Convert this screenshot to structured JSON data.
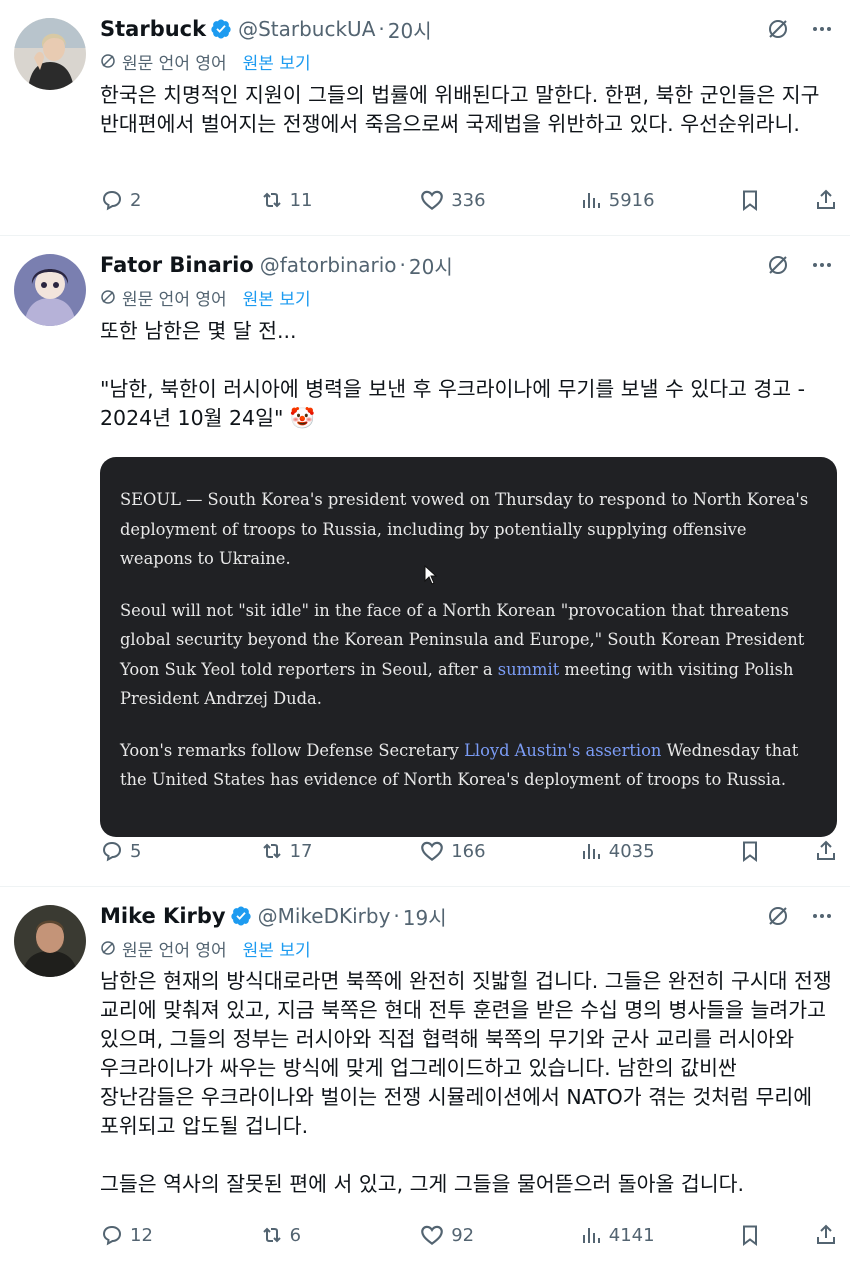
{
  "tweets": [
    {
      "name": "Starbuck",
      "verified": true,
      "handle": "@StarbuckUA",
      "time": "20시",
      "translate_label": "원문 언어 영어",
      "show_original": "원본 보기",
      "text": [
        "한국은 치명적인 지원이 그들의 법률에 위배된다고 말한다. 한편, 북한 군인들은 지구 반대편에서 벌어지는 전쟁에서 죽음으로써 국제법을 위반하고 있다. 우선순위라니."
      ],
      "replies": "2",
      "reposts": "11",
      "likes": "336",
      "views": "5916"
    },
    {
      "name": "Fator Binario",
      "verified": false,
      "handle": "@fatorbinario",
      "time": "20시",
      "translate_label": "원문 언어 영어",
      "show_original": "원본 보기",
      "text": [
        "또한 남한은 몇 달 전...",
        "\"남한, 북한이 러시아에 병력을 보낸 후 우크라이나에 무기를 보낼 수 있다고 경고 - 2024년 10월 24일\" 🤡"
      ],
      "quote": {
        "p1": "SEOUL — South Korea's president vowed on Thursday to respond to North Korea's deployment of troops to Russia, including by potentially supplying offensive weapons to Ukraine.",
        "p2_a": "Seoul will not \"sit idle\" in the face of a North Korean \"provocation that threatens global security beyond the Korean Peninsula and Europe,\" South Korean President Yoon Suk Yeol told reporters in Seoul, after a ",
        "p2_link": "summit",
        "p2_b": " meeting with visiting Polish President Andrzej Duda.",
        "p3_a": "Yoon's remarks follow Defense Secretary ",
        "p3_link": "Lloyd Austin's assertion",
        "p3_b": " Wednesday that the United States has evidence of North Korea's deployment of troops to Russia."
      },
      "replies": "5",
      "reposts": "17",
      "likes": "166",
      "views": "4035"
    },
    {
      "name": "Mike Kirby",
      "verified": true,
      "handle": "@MikeDKirby",
      "time": "19시",
      "translate_label": "원문 언어 영어",
      "show_original": "원본 보기",
      "text": [
        "남한은 현재의 방식대로라면 북쪽에 완전히 짓밟힐 겁니다. 그들은 완전히 구시대 전쟁 교리에 맞춰져 있고, 지금 북쪽은 현대 전투 훈련을 받은 수십 명의 병사들을 늘려가고 있으며, 그들의 정부는 러시아와 직접 협력해 북쪽의 무기와 군사 교리를 러시아와 우크라이나가 싸우는 방식에 맞게 업그레이드하고 있습니다. 남한의 값비싼 장난감들은 우크라이나와 벌이는 전쟁 시뮬레이션에서 NATO가 겪는 것처럼 무리에 포위되고 압도될 겁니다.",
        "그들은 역사의 잘못된 편에 서 있고, 그게 그들을 물어뜯으러 돌아올 겁니다."
      ],
      "replies": "12",
      "reposts": "6",
      "likes": "92",
      "views": "4141"
    }
  ],
  "colors": {
    "text": "#0f1419",
    "secondary": "#536471",
    "link": "#1d9bf0",
    "verified": "#1d9bf0",
    "quote_bg": "#202124",
    "quote_link": "#7b9cf5"
  },
  "icons": [
    "verified-badge-icon",
    "grok-icon",
    "more-icon",
    "globe-icon",
    "reply-icon",
    "repost-icon",
    "like-icon",
    "views-icon",
    "bookmark-icon",
    "share-icon"
  ]
}
